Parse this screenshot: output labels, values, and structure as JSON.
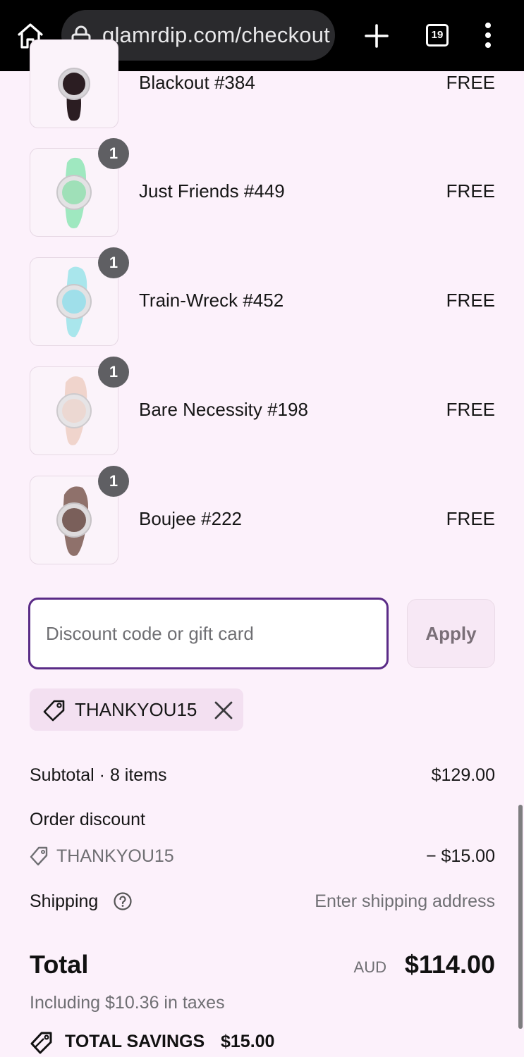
{
  "browser": {
    "url": "glamrdip.com/checkout",
    "tab_count": "19"
  },
  "items": [
    {
      "name": "Blackout #384",
      "price": "FREE",
      "quantity": "",
      "color": "#2b1d22"
    },
    {
      "name": "Just Friends #449",
      "price": "FREE",
      "quantity": "1",
      "color": "#9fe8c0"
    },
    {
      "name": "Train-Wreck #452",
      "price": "FREE",
      "quantity": "1",
      "color": "#a9e6ec"
    },
    {
      "name": "Bare Necessity #198",
      "price": "FREE",
      "quantity": "1",
      "color": "#f0d4cc"
    },
    {
      "name": "Boujee #222",
      "price": "FREE",
      "quantity": "1",
      "color": "#8f716b"
    }
  ],
  "discount": {
    "placeholder": "Discount code or gift card",
    "apply_label": "Apply",
    "applied_code": "THANKYOU15"
  },
  "summary": {
    "subtotal_label": "Subtotal · 8 items",
    "subtotal_value": "$129.00",
    "order_discount_label": "Order discount",
    "discount_code": "THANKYOU15",
    "discount_value": "− $15.00",
    "shipping_label": "Shipping",
    "shipping_value": "Enter shipping address",
    "total_label": "Total",
    "currency": "AUD",
    "total_value": "$114.00",
    "taxes_note": "Including $10.36 in taxes",
    "savings_label": "TOTAL SAVINGS",
    "savings_value": "$15.00"
  },
  "colors": {
    "page_bg": "#fcf1fb",
    "accent": "#5a2b87",
    "chip_bg": "#f3e0f1"
  }
}
